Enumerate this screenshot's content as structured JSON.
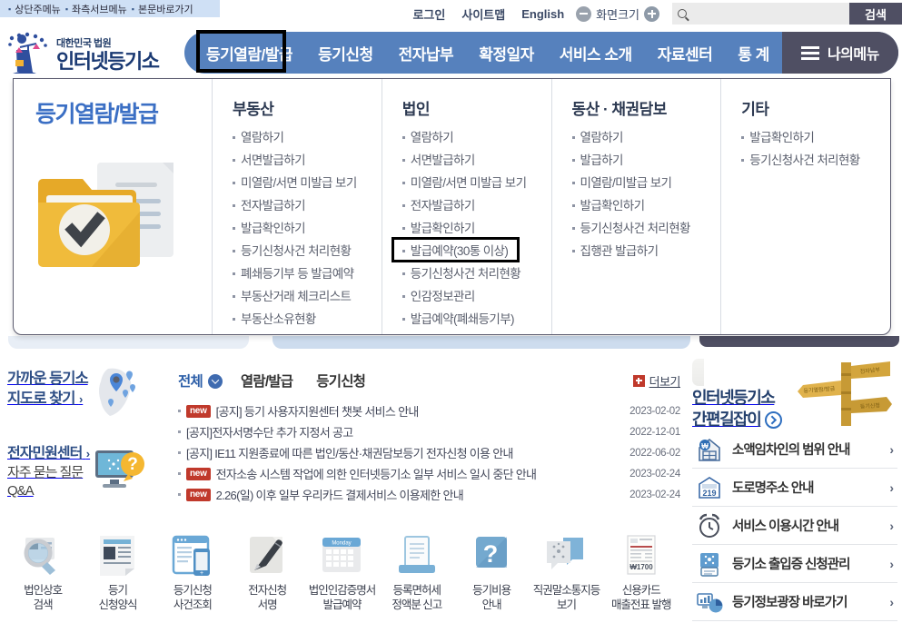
{
  "skip_links": [
    {
      "label": "상단주메뉴"
    },
    {
      "label": "좌측서브메뉴"
    },
    {
      "label": "본문바로가기"
    }
  ],
  "utility": {
    "login": "로그인",
    "sitemap": "사이트맵",
    "english": "English",
    "zoom_label": "화면크기",
    "zoom_out_icon": "minus-circle-icon",
    "zoom_in_icon": "plus-circle-icon",
    "search_placeholder": "",
    "search_value": "",
    "search_button": "검색",
    "search_icon": "search-icon"
  },
  "logo": {
    "sub": "대한민국 법원",
    "main": "인터넷등기소",
    "icon": "court-scales-logo-icon"
  },
  "gnb": {
    "items": [
      {
        "label": "등기열람/발급",
        "active": true
      },
      {
        "label": "등기신청",
        "active": false
      },
      {
        "label": "전자납부",
        "active": false
      },
      {
        "label": "확정일자",
        "active": false
      },
      {
        "label": "서비스 소개",
        "active": false
      },
      {
        "label": "자료센터",
        "active": false
      },
      {
        "label": "통 계",
        "active": false
      }
    ],
    "mymenu": "나의메뉴",
    "mymenu_icon": "hamburger-icon"
  },
  "mega_menu": {
    "title": "등기열람/발급",
    "illustration": "folder-check-icon",
    "columns": [
      {
        "heading": "부동산",
        "items": [
          {
            "label": "열람하기"
          },
          {
            "label": "서면발급하기"
          },
          {
            "label": "미열람/서면 미발급 보기"
          },
          {
            "label": "전자발급하기"
          },
          {
            "label": "발급확인하기"
          },
          {
            "label": "등기신청사건 처리현황"
          },
          {
            "label": "폐쇄등기부 등 발급예약"
          },
          {
            "label": "부동산거래 체크리스트"
          },
          {
            "label": "부동산소유현황"
          }
        ]
      },
      {
        "heading": "법인",
        "items": [
          {
            "label": "열람하기"
          },
          {
            "label": "서면발급하기"
          },
          {
            "label": "미열람/서면 미발급 보기"
          },
          {
            "label": "전자발급하기"
          },
          {
            "label": "발급확인하기"
          },
          {
            "label": "발급예약(30통 이상)",
            "highlighted": true
          },
          {
            "label": "등기신청사건 처리현황"
          },
          {
            "label": "인감정보관리"
          },
          {
            "label": "발급예약(폐쇄등기부)"
          }
        ]
      },
      {
        "heading": "동산 · 채권담보",
        "items": [
          {
            "label": "열람하기"
          },
          {
            "label": "발급하기"
          },
          {
            "label": "미열람/미발급 보기"
          },
          {
            "label": "발급확인하기"
          },
          {
            "label": "등기신청사건 처리현황"
          },
          {
            "label": "집행관 발급하기"
          }
        ]
      },
      {
        "heading": "기타",
        "items": [
          {
            "label": "발급확인하기"
          },
          {
            "label": "등기신청사건 처리현황"
          }
        ]
      }
    ]
  },
  "quick": {
    "map_title_line1": "가까운 등기소",
    "map_title_line2": "지도로 찾기",
    "map_icon": "korea-map-pin-icon",
    "center_title": "전자민원센터",
    "center_line1": "자주 묻는 질문",
    "center_line2": "Q&A",
    "center_icon": "monitor-question-icon",
    "chevron": "›"
  },
  "board": {
    "tabs": [
      {
        "label": "전체",
        "active": true
      },
      {
        "label": "열람/발급",
        "active": false
      },
      {
        "label": "등기신청",
        "active": false
      }
    ],
    "dropdown_icon": "chevron-down-icon",
    "more_label": "더보기",
    "more_icon": "plus-icon",
    "rows": [
      {
        "new": true,
        "title": "[공지] 등기 사용자지원센터 챗봇 서비스 안내",
        "date": "2023-02-02"
      },
      {
        "new": false,
        "title": "[공지]전자서명수단 추가 지정서 공고",
        "date": "2022-12-01"
      },
      {
        "new": false,
        "title": "[공지] IE11 지원종료에 따른 법인/동산·채권담보등기 전자신청 이용 안내",
        "date": "2022-06-02"
      },
      {
        "new": true,
        "title": "전자소송 시스템 작업에 의한 인터넷등기소 일부 서비스 일시 중단 안내",
        "date": "2023-02-24"
      },
      {
        "new": true,
        "title": "2.26(일) 이후 일부 우리카드 결제서비스 이용제한 안내",
        "date": "2023-02-24"
      }
    ]
  },
  "right_panel": {
    "banner_line1": "인터넷등기소",
    "banner_line2": "간편길잡이",
    "banner_icon": "arrow-circle-icon",
    "banner_art": "signpost-icon",
    "links": [
      {
        "label": "소액임차인의 범위 안내",
        "icon": "house-won-icon",
        "chevron": "›"
      },
      {
        "label": "도로명주소 안내",
        "icon": "address-plate-219-icon",
        "chevron": "›"
      },
      {
        "label": "서비스 이용시간 안내",
        "icon": "alarm-clock-icon",
        "chevron": "›"
      },
      {
        "label": "등기소 출입증 신청관리",
        "icon": "id-badge-icon",
        "chevron": "›"
      },
      {
        "label": "등기정보광장 바로가기",
        "icon": "chart-pie-icon",
        "chevron": "›"
      }
    ]
  },
  "icon_row": [
    {
      "caption": "법인상호\n검색",
      "icon": "magnifier-document-icon"
    },
    {
      "caption": "등기\n신청양식",
      "icon": "form-paper-icon"
    },
    {
      "caption": "등기신청\n사건조회",
      "icon": "browser-mobile-icon"
    },
    {
      "caption": "전자신청\n서명",
      "icon": "pen-sign-icon"
    },
    {
      "caption": "법인인감증명서\n발급예약",
      "icon": "calendar-icon"
    },
    {
      "caption": "등록면허세\n정액분 신고",
      "icon": "book-document-icon"
    },
    {
      "caption": "등기비용\n안내",
      "icon": "question-mark-icon"
    },
    {
      "caption": "직권말소통지등\n보기",
      "icon": "speech-bubble-scales-icon"
    },
    {
      "caption": "신용카드\n매출전표 발행",
      "icon": "receipt-w1700-icon"
    }
  ],
  "colors": {
    "gnb_blue": "#5681bd",
    "mymenu_dark": "#4f4f63",
    "accent_blue": "#2d5fa8",
    "new_red": "#c0392b",
    "skip_bg": "#cfe0f5"
  }
}
